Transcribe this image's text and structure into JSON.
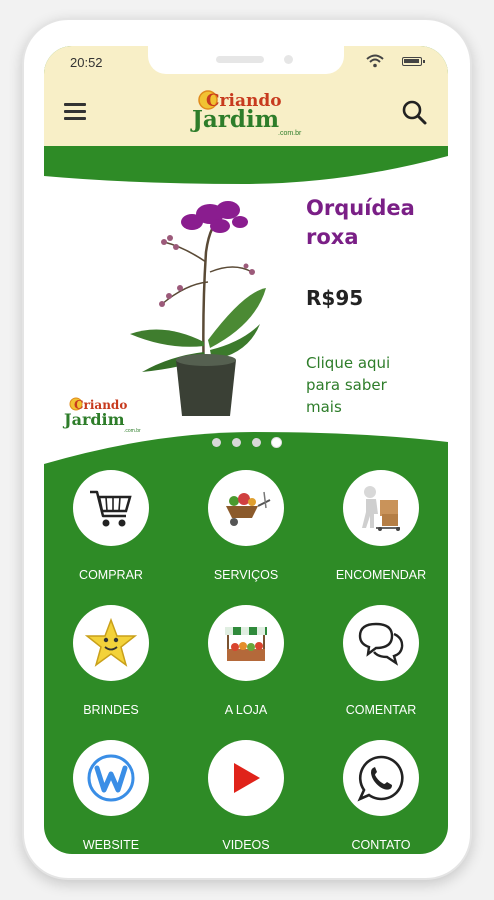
{
  "status_bar": {
    "time": "20:52"
  },
  "app_bar": {
    "logo": {
      "line1": "Criando",
      "line2": "Jardim",
      "suffix": ".com.br"
    },
    "menu_icon": "hamburger-menu-icon",
    "search_icon": "search-icon"
  },
  "banner": {
    "product_name": "Orquídea roxa",
    "price": "R$95",
    "cta": "Clique aqui para saber mais",
    "logo": {
      "line1": "Criando",
      "line2": "Jardim",
      "suffix": ".com.br"
    },
    "slides_total": 4,
    "active_slide": 4
  },
  "menu": [
    {
      "label": "COMPRAR",
      "icon": "shopping-cart-icon"
    },
    {
      "label": "SERVIÇOS",
      "icon": "garden-wheelbarrow-icon"
    },
    {
      "label": "ENCOMENDAR",
      "icon": "delivery-person-icon"
    },
    {
      "label": "BRINDES",
      "icon": "star-character-icon"
    },
    {
      "label": "A LOJA",
      "icon": "market-stall-icon"
    },
    {
      "label": "COMENTAR",
      "icon": "chat-bubbles-icon"
    },
    {
      "label": "WEBSITE",
      "icon": "weebly-w-icon"
    },
    {
      "label": "VIDEOS",
      "icon": "play-icon"
    },
    {
      "label": "CONTATO",
      "icon": "whatsapp-icon"
    }
  ],
  "colors": {
    "header_bg": "#f8efc7",
    "brand_green": "#2e8b26",
    "product_purple": "#7a1f86",
    "logo_orange": "#e08a1c",
    "logo_green": "#2e7d2a"
  }
}
